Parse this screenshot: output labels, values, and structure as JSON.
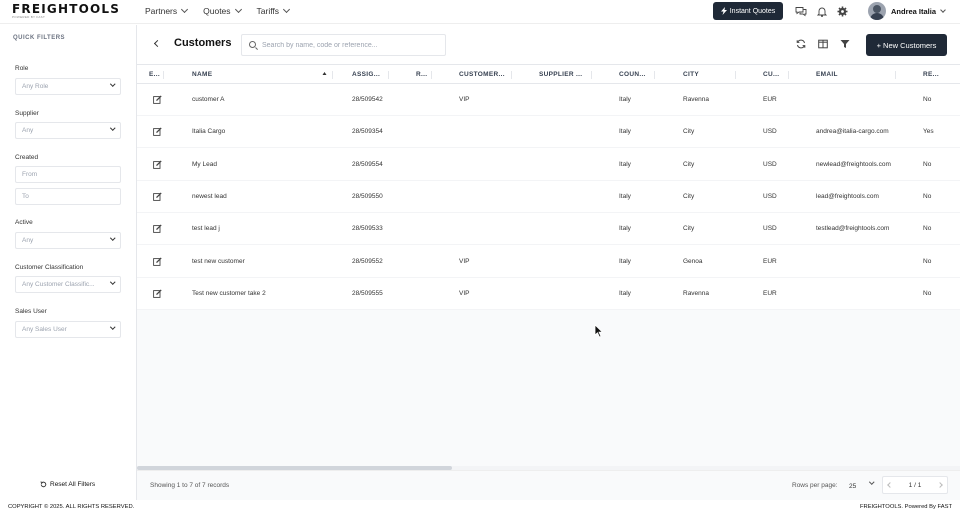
{
  "app": {
    "logo": "FREIGHTOOLS",
    "logo_sub": "POWERED BY FAST"
  },
  "nav": {
    "items": [
      {
        "label": "Partners"
      },
      {
        "label": "Quotes"
      },
      {
        "label": "Tariffs"
      }
    ],
    "instant_quotes": "Instant Quotes",
    "user_name": "Andrea Italia",
    "icons": [
      "chat-icon",
      "bell-icon",
      "gear-icon"
    ]
  },
  "sidebar": {
    "title": "QUICK FILTERS",
    "role": {
      "label": "Role",
      "placeholder": "Any Role"
    },
    "supplier": {
      "label": "Supplier",
      "placeholder": "Any"
    },
    "created": {
      "label": "Created",
      "from": "From",
      "to": "To"
    },
    "active": {
      "label": "Active",
      "placeholder": "Any"
    },
    "classification": {
      "label": "Customer Classification",
      "placeholder": "Any Customer Classific..."
    },
    "sales_user": {
      "label": "Sales User",
      "placeholder": "Any Sales User"
    },
    "reset": "Reset All Filters"
  },
  "main": {
    "title": "Customers",
    "search_placeholder": "Search by name, code or reference...",
    "new_button": "+ New Customers"
  },
  "table": {
    "headers": [
      "E...",
      "NAME",
      "ASSIG...",
      "R...",
      "CUSTOMER...",
      "SUPPLIER ...",
      "COUN...",
      "CITY",
      "CU...",
      "EMAIL",
      "RE..."
    ],
    "sorted_column": "NAME",
    "rows": [
      {
        "name": "customer A",
        "assigned": "28/509542",
        "r": "",
        "customer": "VIP",
        "supplier": "",
        "country": "Italy",
        "city": "Ravenna",
        "currency": "EUR",
        "email": "",
        "re": "No"
      },
      {
        "name": "Italia Cargo",
        "assigned": "28/509354",
        "r": "",
        "customer": "",
        "supplier": "",
        "country": "Italy",
        "city": "City",
        "currency": "USD",
        "email": "andrea@italia-cargo.com",
        "re": "Yes"
      },
      {
        "name": "My Lead",
        "assigned": "28/509554",
        "r": "",
        "customer": "",
        "supplier": "",
        "country": "Italy",
        "city": "City",
        "currency": "USD",
        "email": "newlead@freightools.com",
        "re": "No"
      },
      {
        "name": "newest lead",
        "assigned": "28/509550",
        "r": "",
        "customer": "",
        "supplier": "",
        "country": "Italy",
        "city": "City",
        "currency": "USD",
        "email": "lead@freightools.com",
        "re": "No"
      },
      {
        "name": "test lead j",
        "assigned": "28/509533",
        "r": "",
        "customer": "",
        "supplier": "",
        "country": "Italy",
        "city": "City",
        "currency": "USD",
        "email": "testlead@freightools.com",
        "re": "No"
      },
      {
        "name": "test new customer",
        "assigned": "28/509552",
        "r": "",
        "customer": "VIP",
        "supplier": "",
        "country": "Italy",
        "city": "Genoa",
        "currency": "EUR",
        "email": "",
        "re": "No"
      },
      {
        "name": "Test new customer take 2",
        "assigned": "28/509555",
        "r": "",
        "customer": "VIP",
        "supplier": "",
        "country": "Italy",
        "city": "Ravenna",
        "currency": "EUR",
        "email": "",
        "re": "No"
      }
    ]
  },
  "footer": {
    "showing": "Showing 1 to 7 of 7 records",
    "rows_per_page_label": "Rows per page:",
    "rows_per_page": "25",
    "page": "1 / 1",
    "copyright": "COPYRIGHT © 2025. ALL RIGHTS RESERVED.",
    "powered": "FREIGHTOOLS. Powered By FAST"
  },
  "colors": {
    "primary_dark": "#1f2937",
    "border": "#e5e7eb"
  }
}
